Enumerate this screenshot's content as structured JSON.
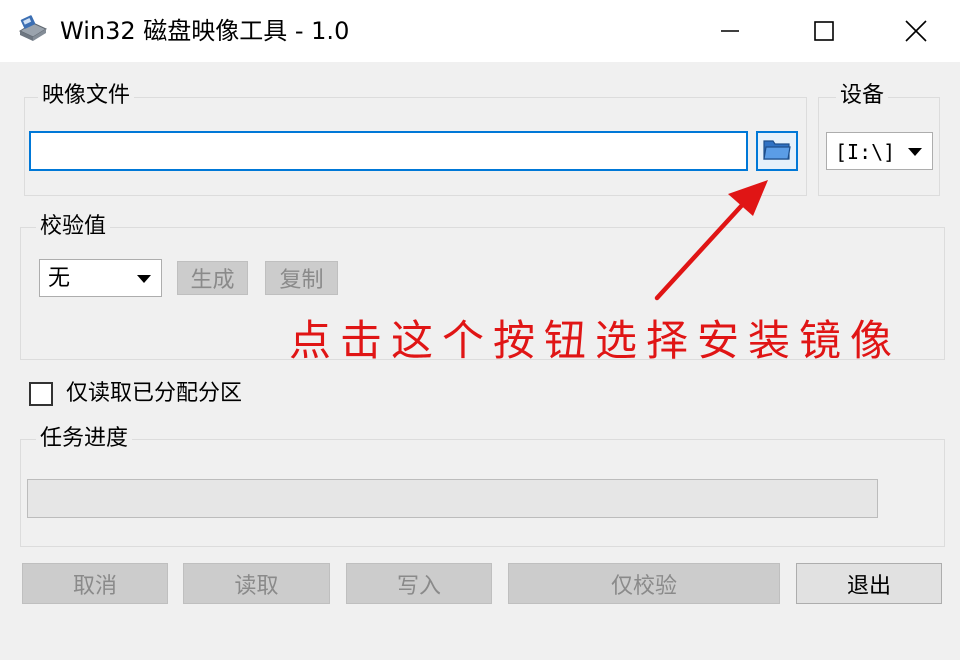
{
  "window": {
    "title": "Win32 磁盘映像工具 - 1.0",
    "icon": "disk-imager-icon",
    "controls": {
      "minimize": "minimize-icon",
      "maximize": "maximize-icon",
      "close": "close-icon"
    }
  },
  "image_file": {
    "group_label": "映像文件",
    "path_value": "",
    "browse_icon": "folder-icon"
  },
  "device": {
    "group_label": "设备",
    "selected": "[I:\\]"
  },
  "checksum": {
    "group_label": "校验值",
    "algorithm_selected": "无",
    "generate_label": "生成",
    "copy_label": "复制"
  },
  "read_only_allocated": {
    "label": "仅读取已分配分区",
    "checked": false
  },
  "progress": {
    "group_label": "任务进度",
    "value": 0
  },
  "buttons": {
    "cancel": "取消",
    "read": "读取",
    "write": "写入",
    "verify_only": "仅校验",
    "exit": "退出"
  },
  "annotation": {
    "text": "点击这个按钮选择安装镜像",
    "color": "#e01515"
  }
}
